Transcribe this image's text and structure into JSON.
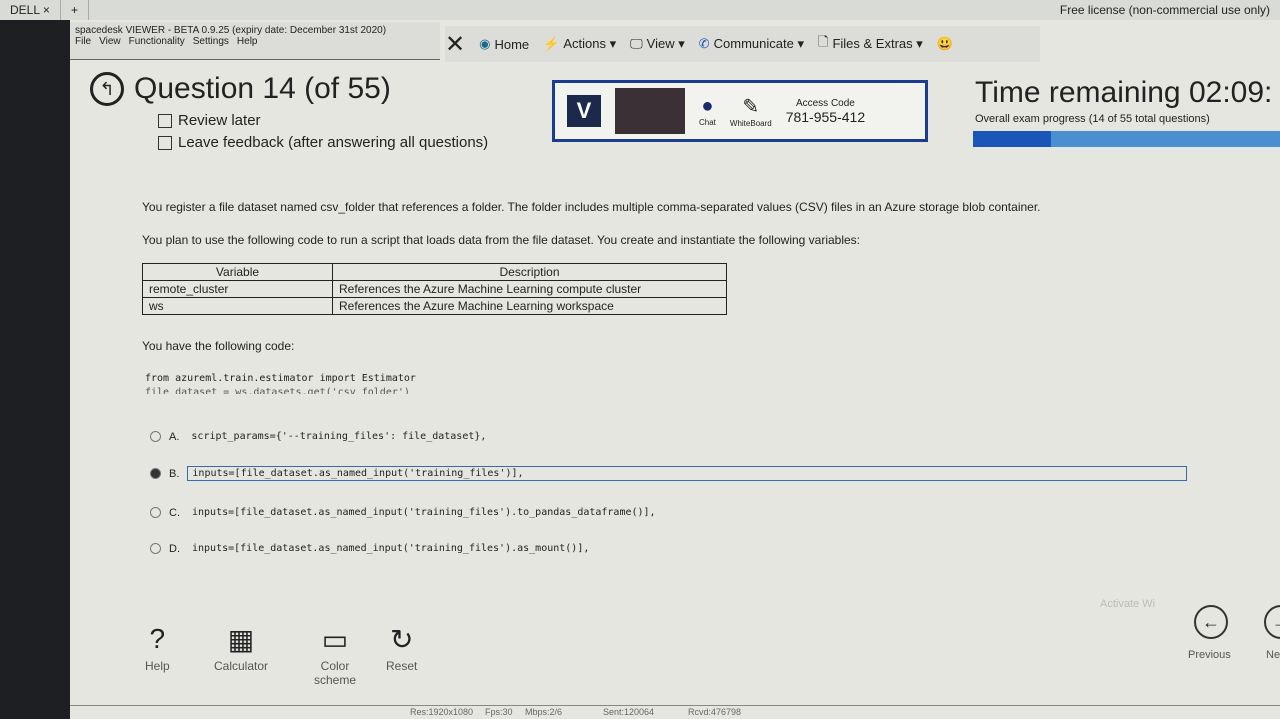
{
  "tabbar": {
    "tab": "DELL",
    "close": "×",
    "add": "+",
    "license": "Free license (non-commercial use only)"
  },
  "viewer": {
    "title": "spacedesk VIEWER - BETA 0.9.25 (expiry date: December 31st 2020)",
    "menu": [
      "File",
      "View",
      "Functionality",
      "Settings",
      "Help"
    ]
  },
  "toolbar": {
    "close": "✕",
    "items": [
      "Home",
      "Actions ▾",
      "View ▾",
      "Communicate ▾",
      "Files & Extras ▾"
    ],
    "emoji": "😃"
  },
  "question": {
    "title": "Question 14 (of 55)",
    "review": "Review later",
    "feedback": "Leave feedback (after answering all questions)"
  },
  "proctor": {
    "logo": "V",
    "chat": "Chat",
    "whiteboard": "WhiteBoard",
    "access_label": "Access Code",
    "access_code": "781-955-412"
  },
  "timer": {
    "label": "Time remaining 02:09:",
    "progress_text": "Overall exam progress (14 of 55 total questions)",
    "progress_fraction": 0.2545
  },
  "body": {
    "p1": "You register a file dataset named csv_folder that references a folder. The folder includes multiple comma-separated values (CSV) files in an Azure storage blob container.",
    "p2": "You plan to use the following code to run a script that loads data from the file dataset. You create and instantiate the following variables:",
    "p3": "You have the following code:"
  },
  "table": {
    "headers": [
      "Variable",
      "Description"
    ],
    "rows": [
      [
        "remote_cluster",
        "References the Azure Machine Learning compute cluster"
      ],
      [
        "ws",
        "References the Azure Machine Learning workspace"
      ]
    ]
  },
  "code": [
    "from azureml.train.estimator import Estimator",
    "file_dataset = ws.datasets.get('csv_folder')"
  ],
  "options": [
    {
      "letter": "A.",
      "text": "script_params={'--training_files': file_dataset},",
      "selected": false
    },
    {
      "letter": "B.",
      "text": "inputs=[file_dataset.as_named_input('training_files')],",
      "selected": true
    },
    {
      "letter": "C.",
      "text": "inputs=[file_dataset.as_named_input('training_files').to_pandas_dataframe()],",
      "selected": false
    },
    {
      "letter": "D.",
      "text": "inputs=[file_dataset.as_named_input('training_files').as_mount()],",
      "selected": false
    }
  ],
  "bottom": {
    "help": "Help",
    "calculator": "Calculator",
    "color": "Color scheme",
    "reset": "Reset",
    "previous": "Previous",
    "next": "Ne",
    "watermark": "Activate Wi"
  },
  "status": {
    "res": "Res:1920x1080",
    "fps": "Fps:30",
    "mbps": "Mbps:2/6",
    "sent": "Sent:120064",
    "rcvd": "Rcvd:476798"
  }
}
